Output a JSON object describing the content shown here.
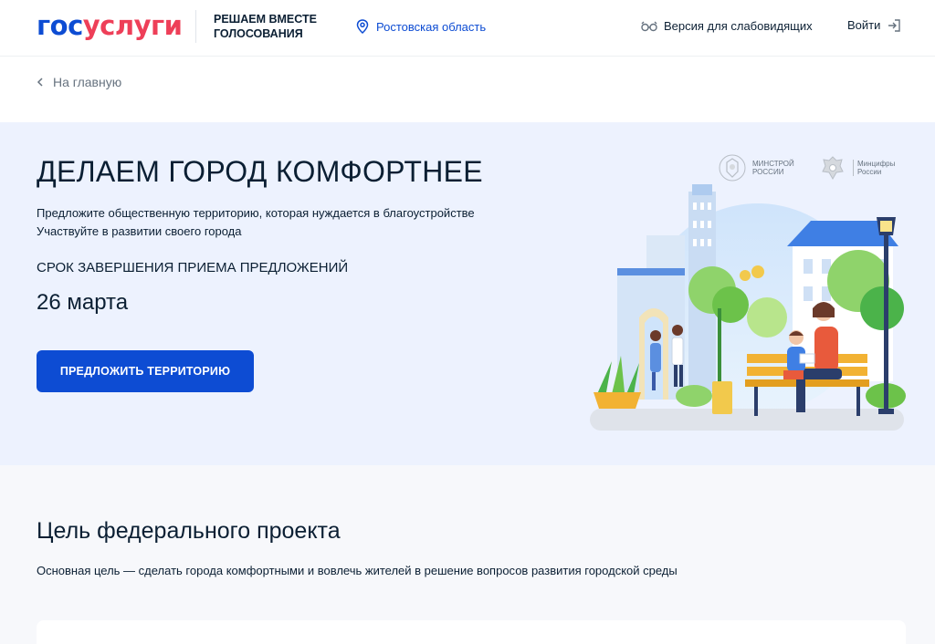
{
  "header": {
    "logo_part1": "гос",
    "logo_part2": "услуги",
    "slogan_line1": "РЕШАЕМ ВМЕСТЕ",
    "slogan_line2": "ГОЛОСОВАНИЯ",
    "region": "Ростовская область",
    "accessibility": "Версия для слабовидящих",
    "login": "Войти"
  },
  "breadcrumb": {
    "back_label": "На главную"
  },
  "hero": {
    "title": "ДЕЛАЕМ ГОРОД КОМФОРТНЕЕ",
    "subtitle_line1": "Предложите общественную территорию, которая нуждается в благоустройстве",
    "subtitle_line2": "Участвуйте в развитии своего города",
    "deadline_label": "СРОК ЗАВЕРШЕНИЯ ПРИЕМА ПРЕДЛОЖЕНИЙ",
    "deadline_date": "26 марта",
    "cta_label": "ПРЕДЛОЖИТЬ ТЕРРИТОРИЮ",
    "ministry1_line1": "МИНСТРОЙ",
    "ministry1_line2": "РОССИИ",
    "ministry2_line1": "Минцифры",
    "ministry2_line2": "России"
  },
  "goal": {
    "title": "Цель федерального проекта",
    "text": "Основная цель — сделать города комфортными и вовлечь жителей в решение вопросов развития городской среды"
  },
  "colors": {
    "brand_blue": "#0d4cd3",
    "brand_red": "#ee3f58",
    "hero_bg": "#edf2fe"
  },
  "icons": {
    "region": "map-pin-icon",
    "accessibility": "glasses-icon",
    "login": "login-icon",
    "back": "chevron-left-icon"
  }
}
